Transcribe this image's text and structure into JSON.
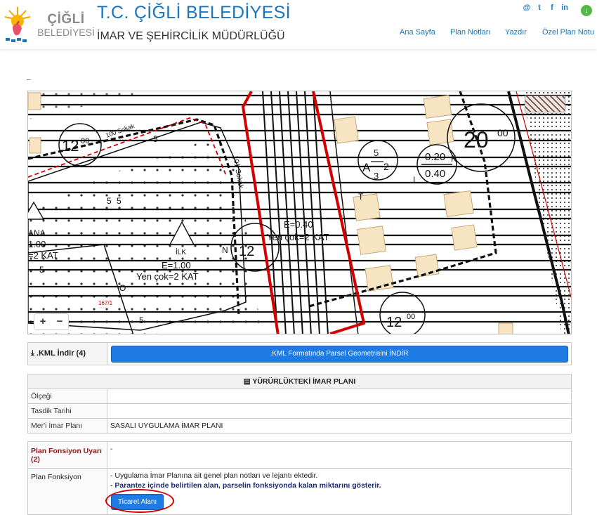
{
  "header": {
    "logo_line1": "ÇİĞLİ",
    "logo_line2": "BELEDİYESİ",
    "title": "T.C. ÇİĞLİ BELEDİYESİ",
    "subtitle": "İMAR VE ŞEHİRCİLİK MÜDÜRLÜĞÜ",
    "social": [
      "@",
      "t",
      "f",
      "in"
    ],
    "social_icons": [
      "email-icon",
      "twitter-icon",
      "facebook-icon",
      "linkedin-icon"
    ],
    "download_icon": "download-icon",
    "nav": [
      "Ana Sayfa",
      "Plan Notları",
      "Yazdır",
      "Özel Plan Notu"
    ]
  },
  "page": {
    "dash": "–"
  },
  "map": {
    "labels": {
      "zone_a": "12",
      "zone_a_sup": "00",
      "zone_b": "20",
      "zone_b_sup": "00",
      "zone_c": "12",
      "zone_c_sup": "00",
      "zone_d": "12",
      "street1": "100 Sokak",
      "street2": "101 Sokak",
      "e_left": "E=1.00",
      "yen_left": "Yen çok=2 KAT",
      "ilk": "İLK",
      "e_mid": "E=0.40",
      "yen_mid": "Yen çok=2 KAT",
      "ratio_top": "0.20",
      "ratio_bot": "0.40",
      "frac_a": "A",
      "frac_num": "5",
      "frac_den": "3",
      "frac_2": "2",
      "left_ana": "ANA",
      "left_e": "1.00",
      "left_kat": "=2 KAT",
      "parcel_1": "167/1",
      "num_5a": "5",
      "num_5b": "5",
      "num_5c": "5",
      "num_5d": "5",
      "num_5e": "5",
      "char_t": "T",
      "char_i": "I",
      "char_k": "K",
      "char_o": "O",
      "char_n": "N"
    },
    "zoom_in": "+",
    "zoom_out": "−"
  },
  "kml": {
    "label": ".KML İndir (4)",
    "label_icon": "download-icon",
    "button": ".KML Formatında Parsel Geometrisini İNDİR"
  },
  "plan": {
    "heading": "YÜRÜRLÜKTEKİ İMAR PLANI",
    "heading_icon": "document-icon",
    "rows": [
      {
        "label": "Ölçeği",
        "value": ""
      },
      {
        "label": "Tasdik Tarihi",
        "value": ""
      },
      {
        "label": "Mer'i İmar Planı",
        "value": "SASALI UYGULAMA İMAR PLANI"
      }
    ]
  },
  "function": {
    "warning_label": "Plan Fonsiyon Uyarı (2)",
    "warning_value": "-",
    "func_label": "Plan Fonksiyon",
    "func_line1": "- Uygulama İmar Planına ait genel plan notları ve lejantı ektedir.",
    "func_line2": "- Parantez içinde belirtilen alan, parselin fonksiyonda kalan miktarını gösterir.",
    "ticaret_button": "Ticaret Alanı"
  },
  "colors": {
    "brand_blue": "#1b75bb",
    "button_blue": "#1e7be3",
    "highlight_red": "#d40000",
    "warning_red": "#8a1a1a",
    "building_fill": "#f7e4c2"
  }
}
